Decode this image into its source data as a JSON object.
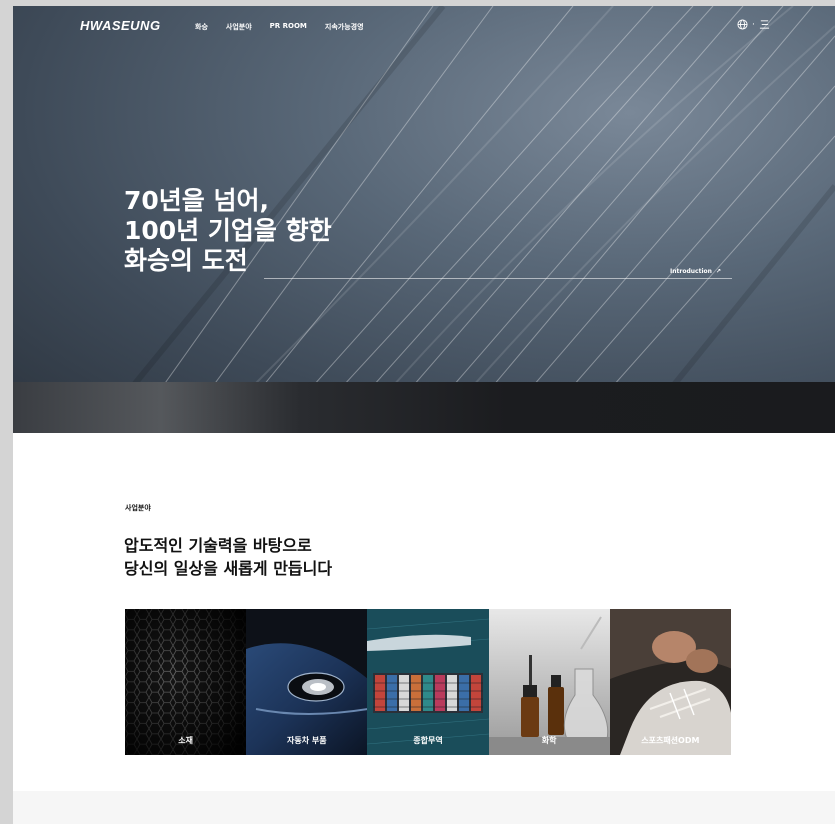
{
  "header": {
    "logo": "HWASEUNG",
    "nav": [
      "화승",
      "사업분야",
      "PR ROOM",
      "지속가능경영"
    ],
    "util_separator": "·"
  },
  "hero": {
    "title_lines": [
      "70년을 넘어,",
      "100년 기업을 향한",
      "화승의 도전"
    ],
    "link_label": "Introduction",
    "link_arrow": "↗"
  },
  "business": {
    "label": "사업분야",
    "heading_lines": [
      "압도적인 기술력을 바탕으로",
      "당신의 일상을 새롭게 만듭니다"
    ],
    "cards": [
      {
        "label": "소재",
        "icon": "honeycomb-material-image"
      },
      {
        "label": "자동차 부품",
        "icon": "car-headlight-image"
      },
      {
        "label": "종합무역",
        "icon": "container-ship-image"
      },
      {
        "label": "화학",
        "icon": "chemistry-bottles-image"
      },
      {
        "label": "스포츠패션ODM",
        "icon": "sneaker-lacing-image"
      }
    ]
  },
  "colors": {
    "hero_dark": "#3e4a58",
    "page_bg": "#ffffff",
    "frame_bg": "#d4d4d4",
    "text": "#111111"
  }
}
